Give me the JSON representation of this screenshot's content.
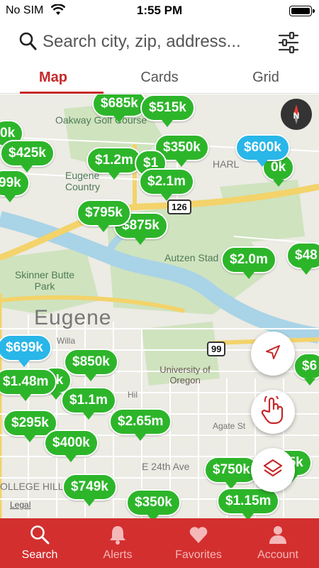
{
  "status": {
    "carrier": "No SIM",
    "time": "1:55 PM"
  },
  "search": {
    "placeholder": "Search city, zip, address..."
  },
  "tabs": [
    {
      "label": "Map"
    },
    {
      "label": "Cards"
    },
    {
      "label": "Grid"
    }
  ],
  "map": {
    "labels": {
      "golf": "Oakway Golf Course",
      "harl": "HARL",
      "eugene_cc": "Eugene Country",
      "autzen": "Autzen Stad",
      "skinner": "Skinner Butte Park",
      "city": "Eugene",
      "willa": "Willa",
      "uo": "University of Oregon",
      "agate": "Agate St",
      "ave24": "E 24th Ave",
      "college": "OLLEGE HILL",
      "hil": "Hil"
    },
    "shields": {
      "s126": "126",
      "s99": "99"
    },
    "legal": "Legal",
    "compass": "N",
    "pins": [
      {
        "price": "$685k",
        "color": "green"
      },
      {
        "price": "$515k",
        "color": "green"
      },
      {
        "price": "0k",
        "color": "green"
      },
      {
        "price": "$425k",
        "color": "green"
      },
      {
        "price": "$1.2m",
        "color": "green"
      },
      {
        "price": "$350k",
        "color": "green"
      },
      {
        "price": "$1",
        "color": "green"
      },
      {
        "price": "$2.1m",
        "color": "green"
      },
      {
        "price": "99k",
        "color": "green"
      },
      {
        "price": "$600k",
        "color": "blue"
      },
      {
        "price": "0k",
        "color": "blue"
      },
      {
        "price": "$795k",
        "color": "green"
      },
      {
        "price": "$875k",
        "color": "green"
      },
      {
        "price": "$2.0m",
        "color": "green"
      },
      {
        "price": "$48",
        "color": "green"
      },
      {
        "price": "$699k",
        "color": "blue"
      },
      {
        "price": "$850k",
        "color": "green"
      },
      {
        "price": "$1.48m",
        "color": "green"
      },
      {
        "price": "9k",
        "color": "green"
      },
      {
        "price": "$1.1m",
        "color": "green"
      },
      {
        "price": "$295k",
        "color": "green"
      },
      {
        "price": "$2.65m",
        "color": "green"
      },
      {
        "price": "$400k",
        "color": "green"
      },
      {
        "price": "$6",
        "color": "green"
      },
      {
        "price": "$750k",
        "color": "green"
      },
      {
        "price": "75k",
        "color": "green"
      },
      {
        "price": "$749k",
        "color": "green"
      },
      {
        "price": "$1.15m",
        "color": "green"
      },
      {
        "price": "$350k",
        "color": "green"
      }
    ]
  },
  "nav": [
    {
      "label": "Search",
      "icon": "search-icon"
    },
    {
      "label": "Alerts",
      "icon": "bell-icon"
    },
    {
      "label": "Favorites",
      "icon": "heart-icon"
    },
    {
      "label": "Account",
      "icon": "person-icon"
    }
  ],
  "colors": {
    "brand": "#d32f2f",
    "pin_green": "#2db52a",
    "pin_blue": "#29b6e8"
  }
}
